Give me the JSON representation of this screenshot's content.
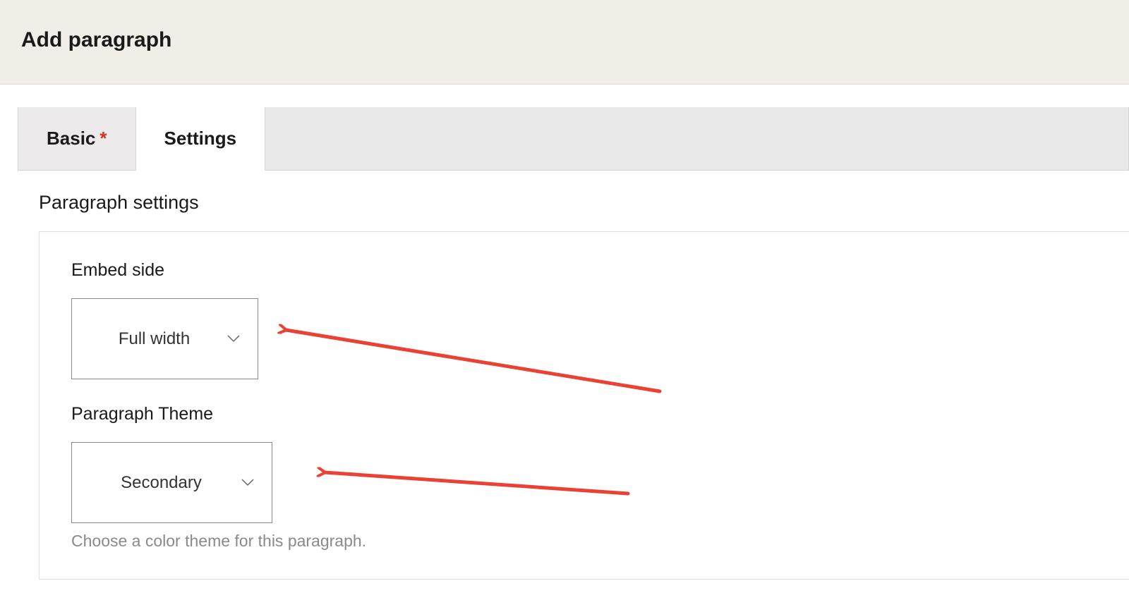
{
  "header": {
    "title": "Add paragraph"
  },
  "tabs": {
    "basic": {
      "label": "Basic",
      "required_marker": "*"
    },
    "settings": {
      "label": "Settings"
    }
  },
  "section": {
    "title": "Paragraph settings"
  },
  "fields": {
    "embed_side": {
      "label": "Embed side",
      "value": "Full width"
    },
    "paragraph_theme": {
      "label": "Paragraph Theme",
      "value": "Secondary",
      "help": "Choose a color theme for this paragraph."
    }
  },
  "annotations": {
    "arrow_color": "#eb4034"
  }
}
